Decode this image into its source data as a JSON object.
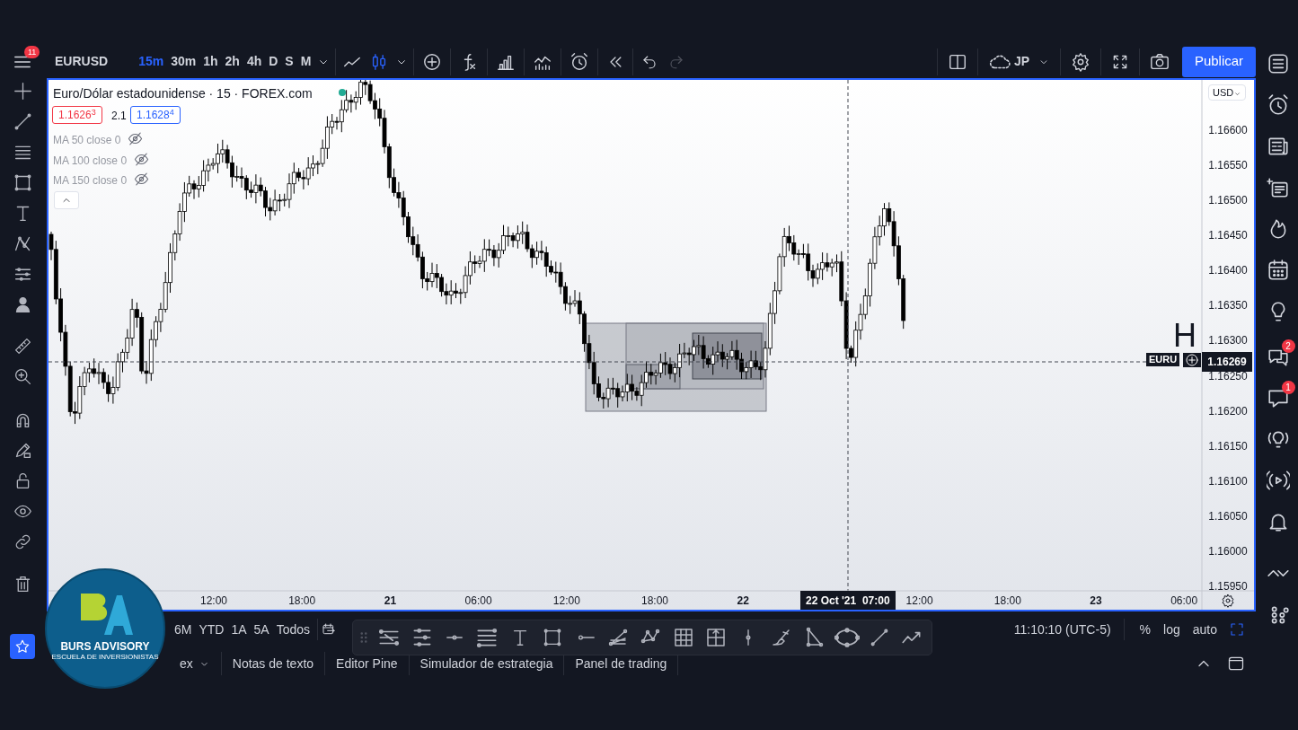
{
  "top_bar": {
    "menu_badge": "11",
    "symbol": "EURUSD",
    "intervals": [
      {
        "label": "15m",
        "selected": true
      },
      {
        "label": "30m",
        "selected": false
      },
      {
        "label": "1h",
        "selected": false
      },
      {
        "label": "2h",
        "selected": false
      },
      {
        "label": "4h",
        "selected": false
      },
      {
        "label": "D",
        "selected": false
      },
      {
        "label": "S",
        "selected": false
      },
      {
        "label": "M",
        "selected": false
      }
    ],
    "cloud_label": "JP",
    "publish_button": "Publicar"
  },
  "chart": {
    "title": "Euro/Dólar estadounidense · 15 · FOREX.com",
    "bid": "1.1626$^{3}$",
    "spread": "2.1",
    "ask": "1.1628$^{4}$",
    "indicators": [
      {
        "label": "MA 50 close 0",
        "hidden": true
      },
      {
        "label": "MA 100 close 0",
        "hidden": true
      },
      {
        "label": "MA 150 close 0",
        "hidden": true
      }
    ],
    "currency": "USD",
    "price_ticks": [
      "1.16600",
      "1.16550",
      "1.16500",
      "1.16450",
      "1.16400",
      "1.16350",
      "1.16300",
      "1.16250",
      "1.16200",
      "1.16150",
      "1.16100",
      "1.16050",
      "1.16000",
      "1.15950"
    ],
    "time_ticks": [
      {
        "label": "12:00",
        "kind": "time"
      },
      {
        "label": "18:00",
        "kind": "time"
      },
      {
        "label": "21",
        "kind": "day"
      },
      {
        "label": "06:00",
        "kind": "time"
      },
      {
        "label": "12:00",
        "kind": "time"
      },
      {
        "label": "18:00",
        "kind": "time"
      },
      {
        "label": "22",
        "kind": "day"
      },
      {
        "label": "12:00",
        "kind": "time"
      },
      {
        "label": "18:00",
        "kind": "time"
      },
      {
        "label": "23",
        "kind": "day"
      },
      {
        "label": "06:00",
        "kind": "time"
      }
    ],
    "crosshair_time": "22 Oct '21  07:00",
    "current_price": "1.16269",
    "symbol_tag": "EURU",
    "overlay_text": "H"
  },
  "bottom_bar": {
    "ranges": [
      "6M",
      "YTD",
      "1A",
      "5A",
      "Todos"
    ],
    "clock": "11:10:10 (UTC-5)",
    "options": [
      "%",
      "log",
      "auto"
    ]
  },
  "bottom_tabs": [
    "ex",
    "Notas de texto",
    "Editor Pine",
    "Simulador de estrategia",
    "Panel de trading"
  ],
  "right_sidebar": {
    "chat_badges": [
      "2",
      "1"
    ]
  },
  "logo": {
    "name": "BURS ADVISORY",
    "tagline": "ESCUELA DE INVERSIONISTAS"
  }
}
